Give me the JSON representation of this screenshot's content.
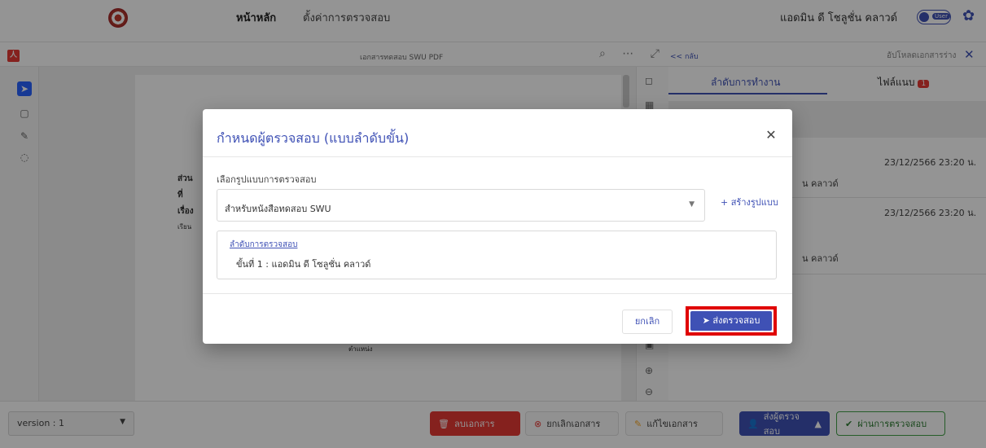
{
  "topbar": {
    "nav_home": "หน้าหลัก",
    "nav_settings": "ตั้งค่าการตรวจสอบ",
    "user_name": "แอดมิน ดี โชลูชั่น คลาวด์",
    "toggle_label": "User"
  },
  "workspace": {
    "pdf_badge": "人",
    "doc_title": "เอกสารทดสอบ SWU  PDF",
    "back_link": "<< กลับ",
    "upload_draft": "อัปโหลดเอกสารร่าง",
    "tab_workflow": "ลำดับการทำงาน",
    "tab_attachments": "ไฟล์แนบ",
    "attachments_count": "1",
    "entries": [
      {
        "date": "23/12/2566 23:20 น.",
        "name": "น คลาวด์"
      },
      {
        "date": "23/12/2566 23:20 น.",
        "name": "น คลาวด์"
      }
    ],
    "doc_fragments": [
      "ส่วน",
      "ที่",
      "เรื่อง",
      "เรียน",
      "ตำแหน่ง"
    ]
  },
  "bottombar": {
    "version": "version : 1",
    "delete_doc": "ลบเอกสาร",
    "cancel_doc": "ยกเลิกเอกสาร",
    "edit_doc": "แก้ไขเอกสาร",
    "send_reviewer": "ส่งผู้ตรวจสอบ",
    "approve": "ผ่านการตรวจสอบ"
  },
  "modal": {
    "title": "กำหนดผู้ตรวจสอบ (แบบลำดับขั้น)",
    "select_label": "เลือกรูปแบบการตรวจสอบ",
    "select_value": "สำหรับหนังสือทดสอบ SWU",
    "create_link": "+ สร้างรูปแบบ",
    "order_title": "ลำดับการตรวจสอบ",
    "order_step": "ขั้นที่ 1 : แอดมิน ดี โซลูชั่น คลาวด์",
    "cancel_button": "ยกเลิก",
    "submit_button": "ส่งตรวจสอบ"
  },
  "colors": {
    "accent": "#3f51b5",
    "danger": "#e53935",
    "highlight": "#e00000",
    "success": "#43a047"
  }
}
